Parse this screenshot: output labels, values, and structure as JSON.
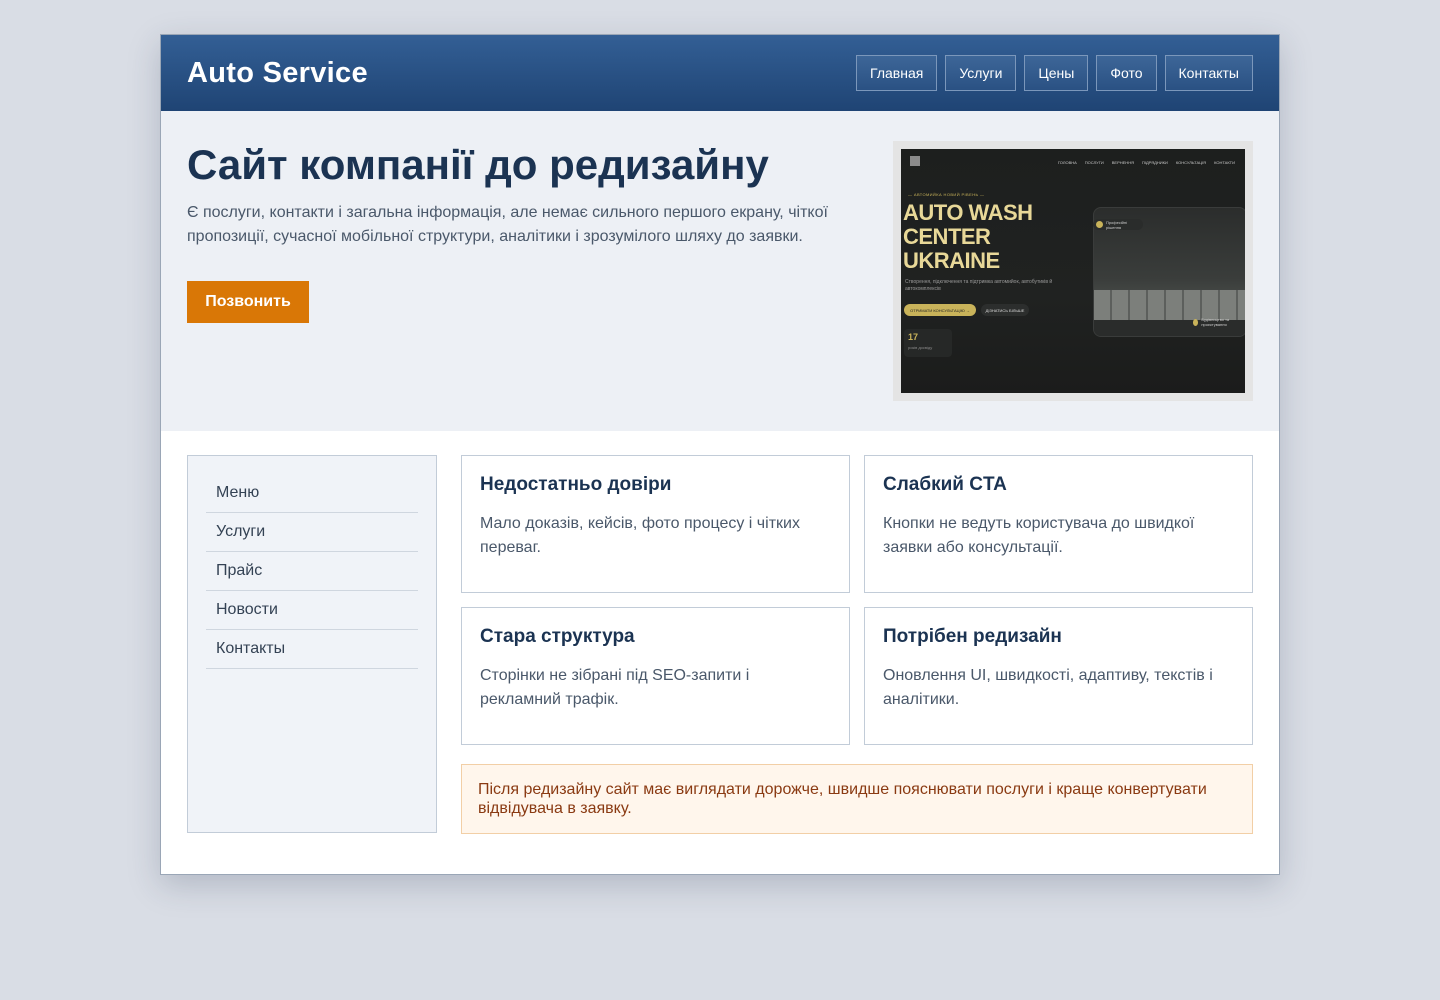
{
  "header": {
    "logo": "Auto Service",
    "nav": [
      "Главная",
      "Услуги",
      "Цены",
      "Фото",
      "Контакты"
    ]
  },
  "hero": {
    "title": "Сайт компанії до редизайну",
    "text": "Є послуги, контакти і загальна інформація, але немає сильного першого екрану, чіткої пропозиції, сучасної мобільної структури, аналітики і зрозумілого шляху до заявки.",
    "cta_label": "Позвонить"
  },
  "preview": {
    "nav": [
      "ГОЛОВНА",
      "ПОСЛУГИ",
      "ВЕРНЕННЯ",
      "ПІДРЯДНИКИ",
      "КОНСУЛЬТАЦІЯ",
      "КОНТАКТИ"
    ],
    "kicker": "— АВТОМИЙКА НОВИЙ РІВЕНЬ —",
    "title_lines": [
      "AUTO WASH",
      "CENTER",
      "UKRAINE"
    ],
    "desc": "Створення, підключення та підтримка автомийок, автобутиків й автокомплексів",
    "btn_primary": "ОТРИМАТИ КОНСУЛЬТАЦІЮ →",
    "btn_secondary": "ДІЗНАТИСЬ БІЛЬШЕ",
    "stat_value": "17",
    "stat_label": "років досвіду",
    "pill": "Професійні рішення",
    "tag": "Будівництво та проєктування",
    "colors": {
      "accent": "#c9b35a",
      "background": "#1d1f1e"
    }
  },
  "sidebar": {
    "items": [
      "Меню",
      "Услуги",
      "Прайс",
      "Новости",
      "Контакты"
    ]
  },
  "cards": [
    {
      "title": "Недостатньо довіри",
      "text": "Мало доказів, кейсів, фото процесу і чітких переваг."
    },
    {
      "title": "Слабкий CTA",
      "text": "Кнопки не ведуть користувача до швидкої заявки або консультації."
    },
    {
      "title": "Стара структура",
      "text": "Сторінки не зібрані під SEO-запити і рекламний трафік."
    },
    {
      "title": "Потрібен редизайн",
      "text": "Оновлення UI, швидкості, адаптиву, текстів і аналітики."
    }
  ],
  "note": "Після редизайну сайт має виглядати дорожче, швидше пояснювати послуги і краще конвертувати відвідувача в заявку.",
  "colors": {
    "header_top": "#335f95",
    "header_bottom": "#1f4474",
    "cta": "#d97706",
    "title": "#1b3352",
    "page_bg": "#d9dde5",
    "note_bg": "#fff6ec",
    "note_text": "#8a3a12"
  }
}
